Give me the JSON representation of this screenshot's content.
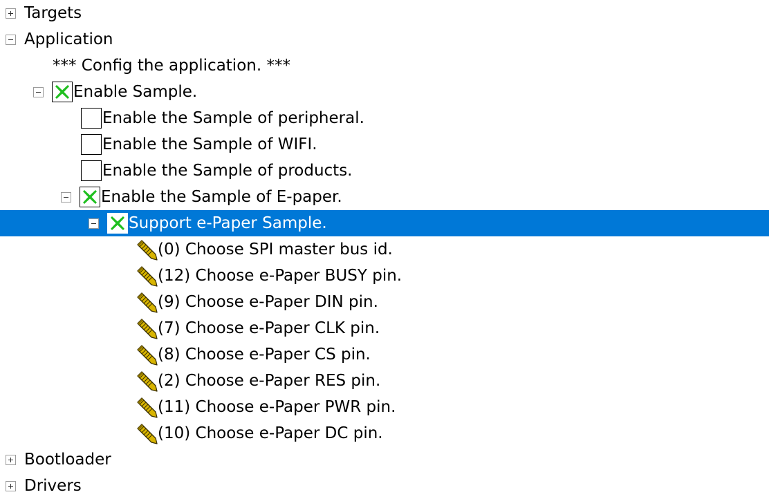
{
  "colors": {
    "selection": "#0078d7",
    "check_mark": "#1fbf1f",
    "pencil_fill": "#d8b400"
  },
  "tree": {
    "targets_label": "Targets",
    "application_label": "Application",
    "config_label": "*** Config the application. ***",
    "enable_sample_label": "Enable Sample.",
    "peripheral_label": "Enable the Sample of peripheral.",
    "wifi_label": "Enable the Sample of WIFI.",
    "products_label": "Enable the Sample of products.",
    "epaper_label": "Enable the Sample of E-paper.",
    "support_epaper_label": "Support e-Paper Sample.",
    "options": [
      "(0) Choose SPI master bus id.",
      "(12) Choose e-Paper BUSY pin.",
      "(9) Choose e-Paper DIN pin.",
      "(7) Choose e-Paper CLK pin.",
      "(8) Choose e-Paper CS pin.",
      "(2) Choose e-Paper RES pin.",
      "(11) Choose e-Paper PWR pin.",
      "(10) Choose e-Paper DC pin."
    ],
    "bootloader_label": "Bootloader",
    "drivers_label": "Drivers"
  },
  "state": {
    "targets_expanded": false,
    "application_expanded": true,
    "enable_sample_checked": true,
    "peripheral_checked": false,
    "wifi_checked": false,
    "products_checked": false,
    "epaper_checked": true,
    "support_epaper_checked": true,
    "selected_item": "Support e-Paper Sample.",
    "bootloader_expanded": false,
    "drivers_expanded": false
  },
  "icons": {
    "expand": "plus-box-icon",
    "collapse": "minus-box-icon",
    "checked": "green-x-check-icon",
    "option": "pencil-icon"
  }
}
